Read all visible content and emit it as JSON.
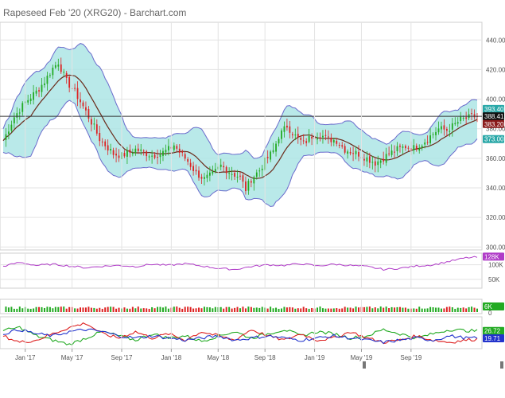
{
  "title": "Rapeseed Feb '20 (XRG20) - Barchart.com",
  "colors": {
    "band_fill": "#a8e4e4",
    "band_line": "#6a6acc",
    "ma_line": "#6b2a1a",
    "up_candle": "#22aa22",
    "down_candle": "#dd2222",
    "volume_line": "#b03cc8",
    "adx_green": "#22aa22",
    "adx_red": "#dd2222",
    "adx_blue": "#2233cc",
    "hline": "#333333",
    "grid": "#e3e3e3"
  },
  "x_axis": {
    "labels": [
      "Jan '17",
      "May '17",
      "Sep '17",
      "Jan '18",
      "May '18",
      "Sep '18",
      "Jan '19",
      "May '19",
      "Sep '19"
    ]
  },
  "chart_data": [
    {
      "type": "candlestick",
      "title": "Rapeseed Feb '20 (XRG20) - Barchart.com",
      "y_ticks": [
        300,
        320,
        340,
        360,
        380,
        400,
        420,
        440
      ],
      "ylim": [
        298,
        452
      ],
      "x_range": [
        "Dec '16",
        "Dec '19"
      ],
      "close_path": [
        [
          0,
          372
        ],
        [
          4,
          388
        ],
        [
          8,
          398
        ],
        [
          12,
          405
        ],
        [
          15,
          412
        ],
        [
          18,
          421
        ],
        [
          20,
          425
        ],
        [
          23,
          412
        ],
        [
          26,
          405
        ],
        [
          29,
          395
        ],
        [
          31,
          388
        ],
        [
          33,
          381
        ],
        [
          35,
          373
        ],
        [
          38,
          367
        ],
        [
          40,
          363
        ],
        [
          43,
          362
        ],
        [
          46,
          364
        ],
        [
          48,
          366
        ],
        [
          51,
          364
        ],
        [
          54,
          362
        ],
        [
          57,
          363
        ],
        [
          60,
          366
        ],
        [
          62,
          369
        ],
        [
          64,
          364
        ],
        [
          67,
          358
        ],
        [
          70,
          350
        ],
        [
          73,
          346
        ],
        [
          76,
          349
        ],
        [
          79,
          355
        ],
        [
          82,
          351
        ],
        [
          84,
          349
        ],
        [
          86,
          347
        ],
        [
          88,
          339
        ],
        [
          90,
          346
        ],
        [
          93,
          352
        ],
        [
          95,
          358
        ],
        [
          98,
          365
        ],
        [
          100,
          375
        ],
        [
          103,
          382
        ],
        [
          106,
          375
        ],
        [
          109,
          370
        ],
        [
          112,
          375
        ],
        [
          115,
          376
        ],
        [
          118,
          373
        ],
        [
          121,
          372
        ],
        [
          124,
          366
        ],
        [
          127,
          364
        ],
        [
          129,
          363
        ],
        [
          132,
          360
        ],
        [
          135,
          357
        ],
        [
          137,
          359
        ],
        [
          140,
          363
        ],
        [
          143,
          366
        ],
        [
          146,
          368
        ],
        [
          149,
          367
        ],
        [
          152,
          370
        ],
        [
          155,
          375
        ],
        [
          158,
          380
        ],
        [
          161,
          379
        ],
        [
          164,
          383
        ],
        [
          166,
          386
        ],
        [
          170,
          388
        ],
        [
          172,
          388.41
        ]
      ],
      "current_price": 388.41,
      "badges": [
        {
          "label": "393.40",
          "value": 393.4,
          "color": "#2aa8a8"
        },
        {
          "label": "388.41",
          "value": 388.41,
          "color": "#111111"
        },
        {
          "label": "383.20",
          "value": 383.2,
          "color": "#8a1a1a"
        },
        {
          "label": "373.00",
          "value": 373.0,
          "color": "#2aa8a8"
        }
      ]
    },
    {
      "type": "line",
      "name": "volume_line",
      "y_ticks": [
        {
          "value": 50000,
          "label": "50K"
        },
        {
          "value": 100000,
          "label": "100K"
        }
      ],
      "ylim": [
        20000,
        140000
      ],
      "path": [
        [
          0,
          95000
        ],
        [
          6,
          108000
        ],
        [
          12,
          98000
        ],
        [
          18,
          102000
        ],
        [
          24,
          96000
        ],
        [
          30,
          90000
        ],
        [
          36,
          95000
        ],
        [
          42,
          98000
        ],
        [
          48,
          94000
        ],
        [
          54,
          102000
        ],
        [
          60,
          98000
        ],
        [
          66,
          104000
        ],
        [
          72,
          96000
        ],
        [
          78,
          88000
        ],
        [
          84,
          84000
        ],
        [
          90,
          94000
        ],
        [
          96,
          100000
        ],
        [
          102,
          98000
        ],
        [
          108,
          104000
        ],
        [
          114,
          96000
        ],
        [
          120,
          102000
        ],
        [
          126,
          98000
        ],
        [
          132,
          94000
        ],
        [
          138,
          84000
        ],
        [
          144,
          88000
        ],
        [
          150,
          96000
        ],
        [
          156,
          100000
        ],
        [
          162,
          112000
        ],
        [
          168,
          124000
        ],
        [
          172,
          126000
        ]
      ],
      "badge": {
        "label": "128K",
        "value": 128000,
        "color": "#b03cc8"
      }
    },
    {
      "type": "bar",
      "name": "volume_bars",
      "y_ticks": [
        {
          "value": 0,
          "label": "0"
        }
      ],
      "badge": {
        "label": "6K",
        "value": 6000,
        "color": "#22aa22"
      }
    },
    {
      "type": "line",
      "name": "adx",
      "series": [
        {
          "color": "#22aa22",
          "path": [
            [
              0,
              27
            ],
            [
              6,
              30
            ],
            [
              12,
              22
            ],
            [
              18,
              18
            ],
            [
              24,
              14
            ],
            [
              30,
              20
            ],
            [
              36,
              26
            ],
            [
              42,
              22
            ],
            [
              48,
              18
            ],
            [
              54,
              24
            ],
            [
              60,
              20
            ],
            [
              66,
              22
            ],
            [
              72,
              17
            ],
            [
              78,
              22
            ],
            [
              84,
              26
            ],
            [
              90,
              20
            ],
            [
              96,
              24
            ],
            [
              102,
              28
            ],
            [
              108,
              22
            ],
            [
              114,
              26
            ],
            [
              120,
              24
            ],
            [
              126,
              20
            ],
            [
              132,
              22
            ],
            [
              138,
              28
            ],
            [
              144,
              24
            ],
            [
              150,
              20
            ],
            [
              156,
              24
            ],
            [
              162,
              28
            ],
            [
              168,
              27
            ],
            [
              172,
              26.72
            ]
          ]
        },
        {
          "color": "#dd2222",
          "path": [
            [
              0,
              22
            ],
            [
              6,
              16
            ],
            [
              12,
              18
            ],
            [
              18,
              24
            ],
            [
              24,
              30
            ],
            [
              30,
              34
            ],
            [
              36,
              24
            ],
            [
              42,
              20
            ],
            [
              48,
              26
            ],
            [
              54,
              20
            ],
            [
              60,
              24
            ],
            [
              66,
              18
            ],
            [
              72,
              26
            ],
            [
              78,
              22
            ],
            [
              84,
              18
            ],
            [
              90,
              28
            ],
            [
              96,
              22
            ],
            [
              102,
              18
            ],
            [
              108,
              24
            ],
            [
              114,
              18
            ],
            [
              120,
              20
            ],
            [
              126,
              26
            ],
            [
              132,
              20
            ],
            [
              138,
              16
            ],
            [
              144,
              18
            ],
            [
              150,
              22
            ],
            [
              156,
              18
            ],
            [
              162,
              16
            ],
            [
              168,
              18
            ],
            [
              172,
              19
            ]
          ]
        },
        {
          "color": "#2233cc",
          "path": [
            [
              0,
              24
            ],
            [
              6,
              28
            ],
            [
              12,
              24
            ],
            [
              18,
              22
            ],
            [
              24,
              26
            ],
            [
              30,
              28
            ],
            [
              36,
              26
            ],
            [
              42,
              22
            ],
            [
              48,
              20
            ],
            [
              54,
              22
            ],
            [
              60,
              20
            ],
            [
              66,
              18
            ],
            [
              72,
              20
            ],
            [
              78,
              22
            ],
            [
              84,
              18
            ],
            [
              90,
              20
            ],
            [
              96,
              22
            ],
            [
              102,
              20
            ],
            [
              108,
              18
            ],
            [
              114,
              20
            ],
            [
              120,
              22
            ],
            [
              126,
              20
            ],
            [
              132,
              18
            ],
            [
              138,
              16
            ],
            [
              144,
              18
            ],
            [
              150,
              20
            ],
            [
              156,
              18
            ],
            [
              162,
              22
            ],
            [
              168,
              20
            ],
            [
              172,
              19.71
            ]
          ]
        }
      ],
      "ylim": [
        10,
        40
      ],
      "badges": [
        {
          "label": "26.72",
          "value": 26.72,
          "color": "#22aa22"
        },
        {
          "label": "19.71",
          "value": 19.71,
          "color": "#2233cc"
        }
      ]
    }
  ]
}
